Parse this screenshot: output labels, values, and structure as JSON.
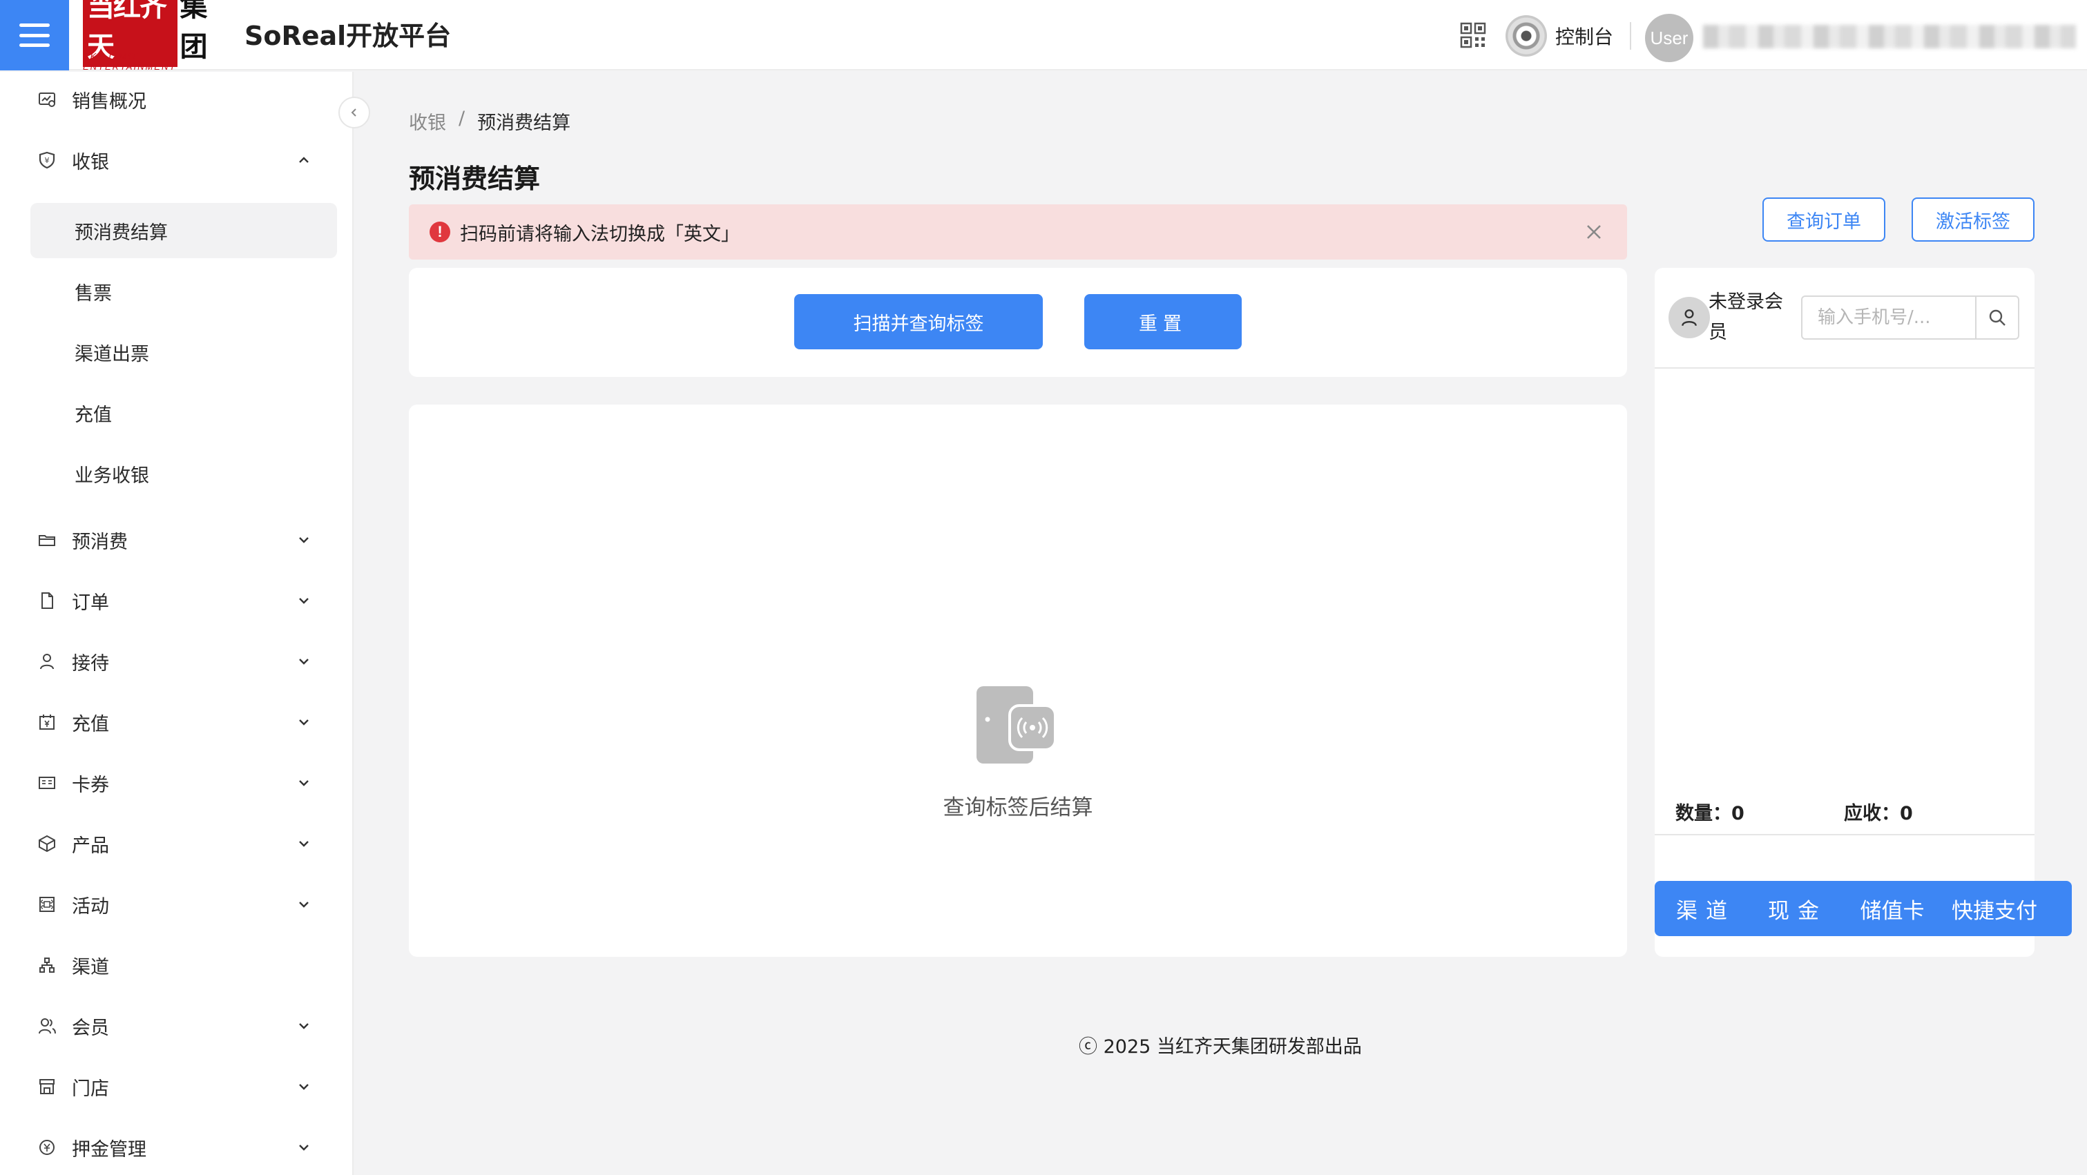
{
  "header": {
    "logo_main_red": "当红齐天",
    "logo_main_black": "集团",
    "logo_sub": "SKY LIMIT ENTERTAINMENT",
    "platform_title": "SoReal开放平台",
    "console_label": "控制台",
    "avatar_text": "User"
  },
  "sidebar": {
    "items": [
      {
        "label": "销售概况",
        "icon": "sales-overview-icon"
      },
      {
        "label": "收银",
        "icon": "shield-icon",
        "expanded": true
      },
      {
        "label": "预消费",
        "icon": "folder-icon"
      },
      {
        "label": "订单",
        "icon": "document-icon"
      },
      {
        "label": "接待",
        "icon": "user-icon"
      },
      {
        "label": "充值",
        "icon": "calendar-icon"
      },
      {
        "label": "卡券",
        "icon": "card-icon"
      },
      {
        "label": "产品",
        "icon": "cube-icon"
      },
      {
        "label": "活动",
        "icon": "command-icon"
      },
      {
        "label": "渠道",
        "icon": "network-icon"
      },
      {
        "label": "会员",
        "icon": "members-icon"
      },
      {
        "label": "门店",
        "icon": "store-icon"
      },
      {
        "label": "押金管理",
        "icon": "deposit-icon"
      }
    ],
    "cashier_sub_items": [
      "预消费结算",
      "售票",
      "渠道出票",
      "充值",
      "业务收银"
    ],
    "active_sub_item": "预消费结算"
  },
  "breadcrumb": {
    "parent": "收银",
    "separator": "/",
    "current": "预消费结算"
  },
  "page_title": "预消费结算",
  "alert": {
    "text": "扫码前请将输入法切换成「英文」",
    "color": "#f8dede"
  },
  "actions": {
    "scan_label": "扫描并查询标签",
    "reset_label": "重置",
    "query_order_label": "查询订单",
    "activate_tag_label": "激活标签"
  },
  "empty_state": {
    "text": "查询标签后结算",
    "icon": "nfc-tag-icon"
  },
  "member": {
    "name": "未登录会员",
    "phone_placeholder": "输入手机号/..."
  },
  "summary": {
    "quantity_label": "数量：",
    "quantity": "0",
    "due_label": "应收：",
    "due": "0"
  },
  "payment": {
    "channel": "渠道",
    "cash": "现金",
    "stored_card": "储值卡",
    "quick_pay": "快捷支付"
  },
  "footer": {
    "text": "ⓒ 2025 当红齐天集团研发部出品"
  },
  "colors": {
    "primary": "#3d86f4",
    "alert_bg": "#f8dede",
    "alert_icon": "#e0383e",
    "logo_red": "#c7111a"
  }
}
